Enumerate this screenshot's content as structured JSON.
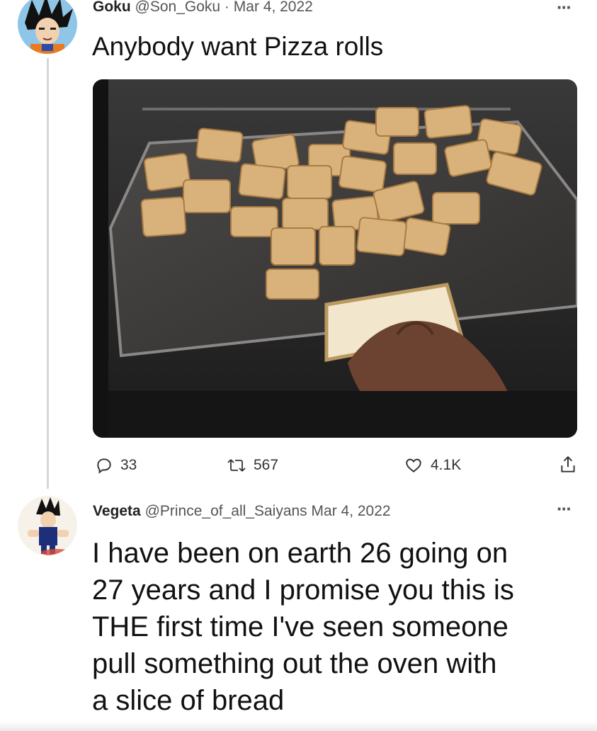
{
  "tweet1": {
    "display_name": "Goku",
    "handle": "@Son_Goku",
    "separator": "·",
    "date": "Mar 4, 2022",
    "text": "Anybody want Pizza rolls",
    "media_icon": "oven-tray-photo",
    "actions": {
      "replies": "33",
      "retweets": "567",
      "likes": "4.1K"
    },
    "icons": [
      "reply-icon",
      "retweet-icon",
      "like-icon",
      "share-icon",
      "more-icon"
    ]
  },
  "tweet2": {
    "display_name": "Vegeta",
    "handle": "@Prince_of_all_Saiyans",
    "date": "Mar 4, 2022",
    "text_lines": [
      "I have been on earth 26 going on",
      "27 years and I promise you this is",
      "THE first time I've seen someone",
      "pull something out the oven with",
      "a slice of bread"
    ]
  },
  "colors": {
    "thread_line": "#cfd9de",
    "text": "#111111",
    "meta": "#555555"
  }
}
